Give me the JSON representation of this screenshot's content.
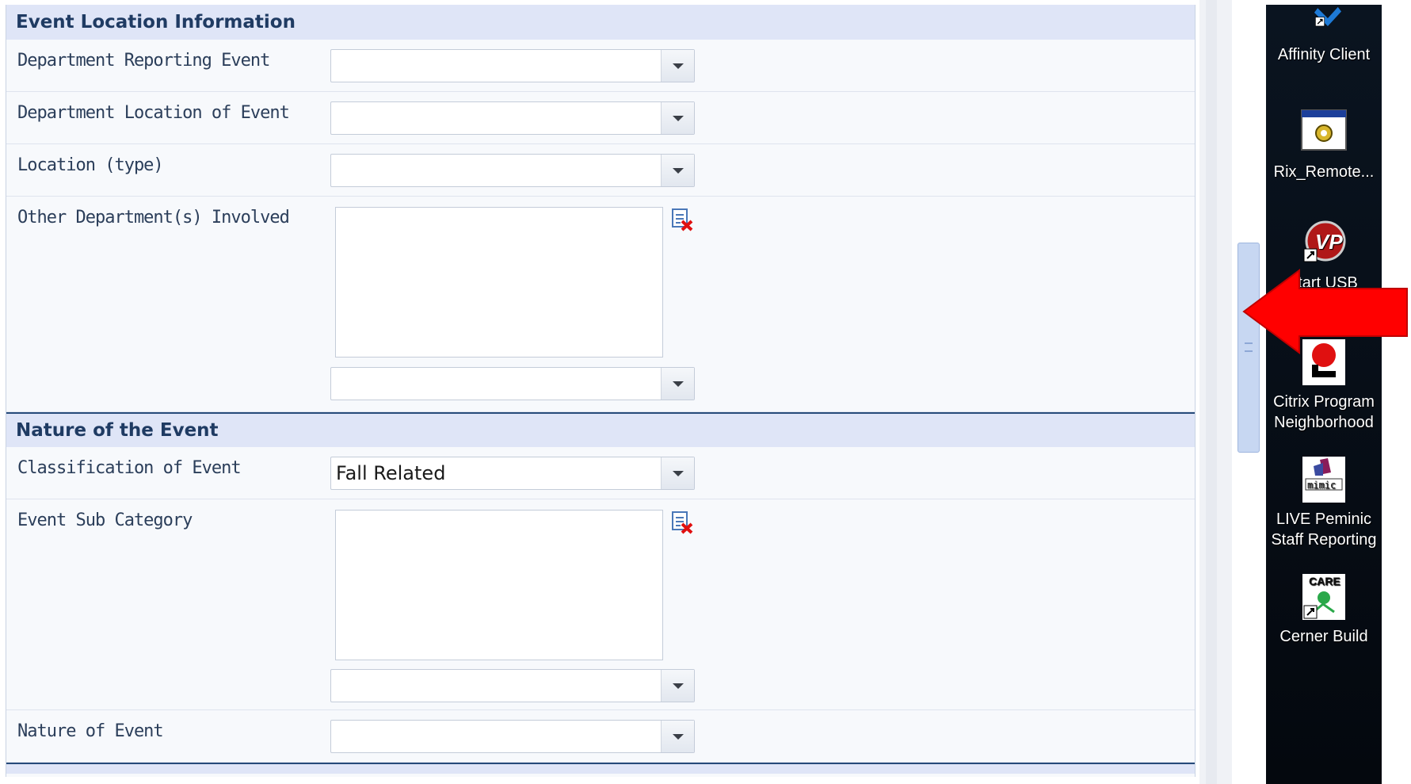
{
  "sections": {
    "location": {
      "title": "Event Location Information",
      "rows": {
        "dept_reporting": {
          "label": "Department Reporting Event",
          "value": ""
        },
        "dept_location": {
          "label": "Department Location of Event",
          "value": ""
        },
        "location_type": {
          "label": "Location (type)",
          "value": ""
        },
        "other_depts": {
          "label": "Other Department(s) Involved",
          "value": ""
        }
      }
    },
    "nature": {
      "title": "Nature of the Event",
      "rows": {
        "classification": {
          "label": "Classification of Event",
          "value": "Fall Related"
        },
        "sub_category": {
          "label": "Event Sub Category",
          "value": ""
        },
        "nature_of_event": {
          "label": "Nature of Event",
          "value": ""
        }
      }
    }
  },
  "desktop": {
    "icons": [
      {
        "name": "affinity-client",
        "label": "Affinity Client"
      },
      {
        "name": "rix-remote",
        "label": "Rix_Remote..."
      },
      {
        "name": "start-usb",
        "label": "start USB"
      },
      {
        "name": "citrix-program-neighborhood",
        "label_line1": "Citrix Program",
        "label_line2": "Neighborhood"
      },
      {
        "name": "live-peminic",
        "label_line1": "LIVE Peminic",
        "label_line2": "Staff Reporting"
      },
      {
        "name": "cerner-build",
        "label": "Cerner Build"
      }
    ]
  },
  "colors": {
    "section_header_bg": "#dfe5f7",
    "section_header_text": "#1f3b63",
    "annotation_arrow": "#ff0000"
  }
}
